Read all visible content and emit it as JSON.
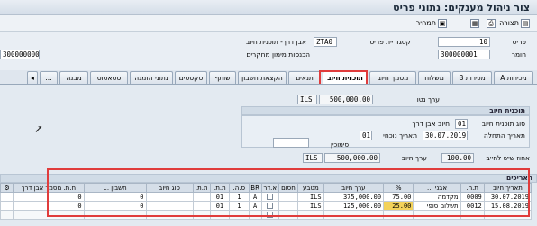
{
  "window": {
    "title": "צור ניהול מענקים: נתוני פריט"
  },
  "toolbar": {
    "display_label": "תמחיר",
    "notes_label": "תצורה"
  },
  "header": {
    "row1": {
      "field_label": "פריט",
      "field_value": "10",
      "cat_label": "קטגוריית פריט",
      "cat_value": "ZTA0",
      "cat_desc": "אבן דרך- תוכנית חיוב"
    },
    "row2": {
      "field_label": "חומר",
      "field_value": "300000001",
      "mat_desc": "הכנסות מימון מחקרים"
    },
    "left_field_value": "300000000"
  },
  "tabs": [
    {
      "label": "מכירות A"
    },
    {
      "label": "מכירות B"
    },
    {
      "label": "משלוח"
    },
    {
      "label": "מסמך חיוב"
    },
    {
      "label": "תוכנית חיוב"
    },
    {
      "label": "תנאים"
    },
    {
      "label": "הקצאת חשבון"
    },
    {
      "label": "שותף"
    },
    {
      "label": "טקסטים"
    },
    {
      "label": "נתוני הזמנה"
    },
    {
      "label": "סטאטוס"
    },
    {
      "label": "מבנה"
    },
    {
      "label": "..."
    }
  ],
  "net_value": {
    "label": "ערך נטו",
    "currency": "ILS",
    "amount": "500,000.00"
  },
  "billing_plan": {
    "section_title": "תוכנית חיוב",
    "type_label": "סוג תוכנית חיוב",
    "type_value": "01",
    "type_desc": "חיוב אבן דרך",
    "start_label": "תאריך התחלה",
    "start_value": "30.07.2019",
    "start_rule_label": "תאריך נוכחי",
    "start_rule_value": "01",
    "sign_label": "סימוכין",
    "sign_value": ""
  },
  "totals": {
    "pct_label": "אחוז שיש לחייב",
    "pct_value": "100.00",
    "value_label": "ערך חיוב",
    "currency": "ILS",
    "value": "500,000.00"
  },
  "dates_table": {
    "title": "תאריכים",
    "columns": [
      "תאריך חיוב",
      "ת.ח.",
      "אבני ...",
      "%",
      "ערך חיוב",
      "מטבע",
      "חסום",
      "א.דר",
      "BR",
      "ס.ה.",
      "ת.ת.",
      "ת.ת.",
      "סוג חיוב",
      "חשבון ...",
      "ח.ת. מסמך אבן דרך"
    ],
    "rows": [
      [
        "30.07.2019",
        "0009",
        "מקדמה",
        "75.00",
        "375,000.00",
        "ILS",
        "",
        "",
        "A",
        "1",
        "01",
        "",
        "",
        "0",
        "0"
      ],
      [
        "15.08.2019",
        "0012",
        "תשלום סופי",
        "25.00",
        "125,000.00",
        "ILS",
        "",
        "",
        "A",
        "1",
        "01",
        "",
        "",
        "0",
        "0"
      ]
    ]
  }
}
